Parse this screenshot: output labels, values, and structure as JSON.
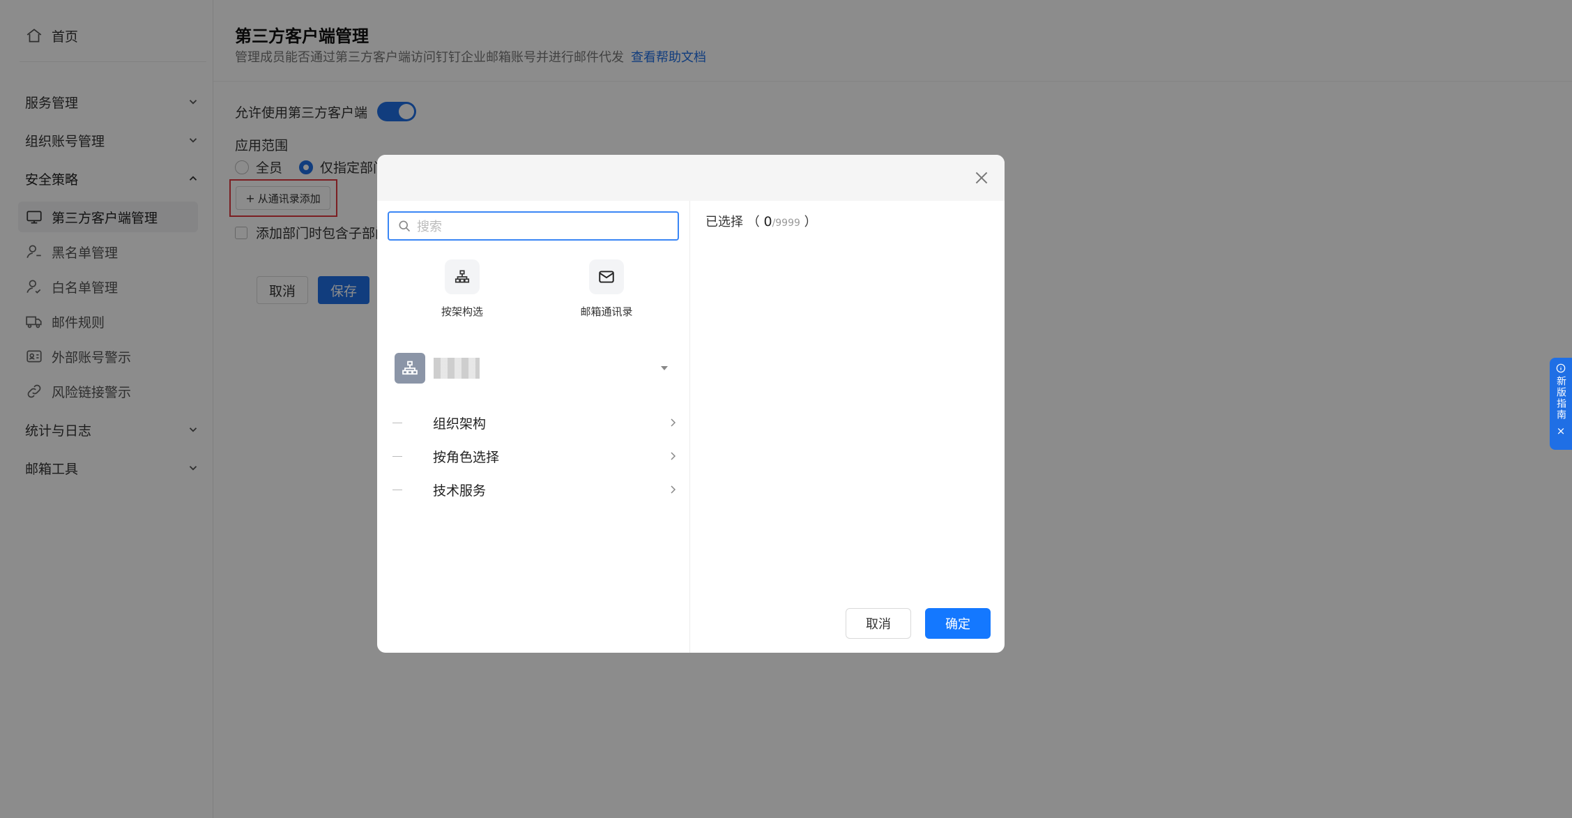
{
  "sidebar": {
    "home": "首页",
    "groups": [
      {
        "label": "服务管理",
        "expanded": false
      },
      {
        "label": "组织账号管理",
        "expanded": false
      },
      {
        "label": "安全策略",
        "expanded": true
      }
    ],
    "items": [
      {
        "label": "第三方客户端管理",
        "icon": "monitor-icon",
        "active": true
      },
      {
        "label": "黑名单管理",
        "icon": "user-block-icon"
      },
      {
        "label": "白名单管理",
        "icon": "user-check-icon"
      },
      {
        "label": "邮件规则",
        "icon": "truck-icon"
      },
      {
        "label": "外部账号警示",
        "icon": "id-card-icon"
      },
      {
        "label": "风险链接警示",
        "icon": "link-icon"
      }
    ],
    "groups_bottom": [
      {
        "label": "统计与日志"
      },
      {
        "label": "邮箱工具"
      }
    ]
  },
  "page": {
    "title": "第三方客户端管理",
    "desc": "管理成员能否通过第三方客户端访问钉钉企业邮箱账号并进行邮件代发",
    "help_link": "查看帮助文档",
    "toggle_label": "允许使用第三方客户端",
    "toggle_on": true,
    "scope_label": "应用范围",
    "scope_options": [
      "全员",
      "仅指定部门"
    ],
    "scope_selected": 1,
    "add_button": "从通讯录添加",
    "include_sub_label": "添加部门时包含子部门",
    "cancel": "取消",
    "save": "保存"
  },
  "guide": {
    "label": "新版指南",
    "close": "×"
  },
  "modal": {
    "search_placeholder": "搜索",
    "quick": [
      {
        "label": "按架构选",
        "icon": "org-tree-icon"
      },
      {
        "label": "邮箱通讯录",
        "icon": "mail-icon"
      }
    ],
    "tree": [
      "组织架构",
      "按角色选择",
      "技术服务"
    ],
    "selected_label": "已选择",
    "selected_count": "0",
    "selected_max": "/9999",
    "cancel": "取消",
    "ok": "确定"
  },
  "colors": {
    "primary": "#1f6fe5",
    "ok_button": "#1478ff",
    "highlight_box": "#e0383e"
  }
}
